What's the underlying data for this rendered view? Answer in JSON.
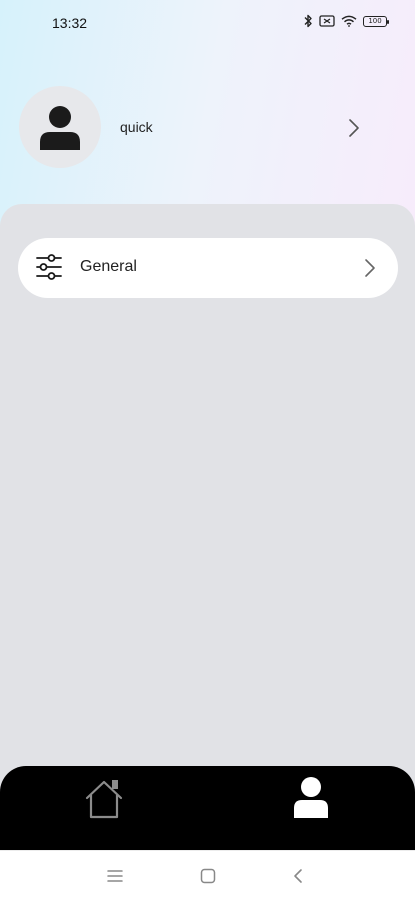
{
  "status_bar": {
    "time": "13:32",
    "battery": "100"
  },
  "profile": {
    "username": "quick"
  },
  "settings": {
    "items": [
      {
        "label": "General",
        "icon": "sliders-icon"
      }
    ]
  },
  "bottom_nav": {
    "items": [
      {
        "icon": "home-icon",
        "active": false
      },
      {
        "icon": "person-icon",
        "active": true
      }
    ]
  },
  "colors": {
    "panel": "#e1e2e6",
    "nav": "#000000",
    "card": "#ffffff"
  }
}
